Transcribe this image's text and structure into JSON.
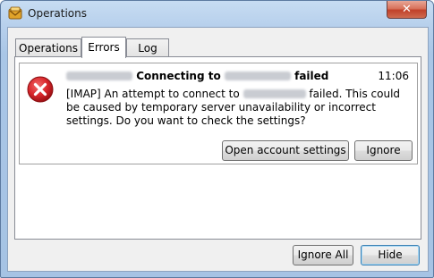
{
  "window": {
    "title": "Operations",
    "close_glyph": "✕",
    "app_icon": "mail-envelope-icon"
  },
  "tabs": [
    {
      "label": "Operations",
      "active": false
    },
    {
      "label": "Errors",
      "active": true
    },
    {
      "label": "Log",
      "active": false
    }
  ],
  "error": {
    "title_mid": "Connecting to",
    "title_end": "failed",
    "time": "11:06",
    "message_part1": "[IMAP] An attempt to connect to",
    "message_part2": "failed. This could be caused by temporary server unavailability or incorrect settings. Do you want to check the settings?",
    "icon": "error-x-icon",
    "open_settings_label": "Open account settings",
    "ignore_label": "Ignore"
  },
  "footer": {
    "ignore_all_label": "Ignore All",
    "hide_label": "Hide"
  },
  "colors": {
    "error_red": "#d8262b",
    "title_bar": "#b7d0ec"
  }
}
